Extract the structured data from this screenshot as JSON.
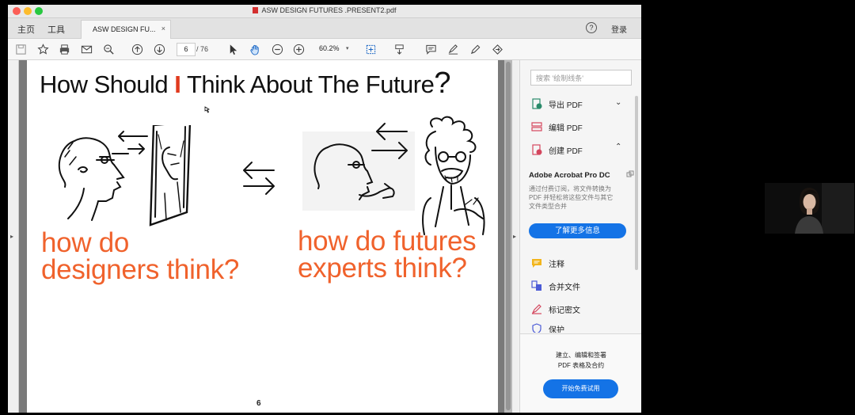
{
  "window": {
    "title": "ASW DESIGN FUTURES .PRESENT2.pdf",
    "nav_home": "主页",
    "nav_tools": "工具",
    "doc_tab": "ASW DESIGN FU...",
    "doc_tab_close": "×",
    "help": "?",
    "login": "登录"
  },
  "toolbar": {
    "current_page": "6",
    "total_pages": "/ 76",
    "zoom": "60.2%"
  },
  "slide": {
    "title_pre": "How Should ",
    "title_i": "I",
    "title_post": " Think About The Future",
    "title_q": "?",
    "left_line1": "how do",
    "left_line2": "designers think?",
    "right_line1": "how do futures",
    "right_line2": "experts think?",
    "page_number": "6"
  },
  "pane": {
    "search_placeholder": "搜索 '绘制线条'",
    "tools": [
      {
        "label": "导出 PDF",
        "icon": "export-pdf-icon"
      },
      {
        "label": "编辑 PDF",
        "icon": "edit-pdf-icon"
      },
      {
        "label": "创建 PDF",
        "icon": "create-pdf-icon"
      },
      {
        "label": "注释",
        "icon": "comment-icon"
      },
      {
        "label": "合并文件",
        "icon": "combine-files-icon"
      },
      {
        "label": "标记密文",
        "icon": "redact-icon"
      },
      {
        "label": "保护",
        "icon": "protect-icon"
      }
    ],
    "promo": {
      "title": "Adobe Acrobat Pro DC",
      "desc_line1": "通过付费订阅，将文件转换为",
      "desc_line2": "PDF 并轻松将这些文件与其它",
      "desc_line3": "文件类型合并",
      "button": "了解更多信息"
    },
    "bottom": {
      "line1": "建立、编辑和签署",
      "line2": "PDF 表格及合约",
      "button": "开始免费试用"
    }
  },
  "colors": {
    "accent_blue": "#1473e6",
    "slide_orange": "#f0622c",
    "title_red": "#e03a1e"
  }
}
